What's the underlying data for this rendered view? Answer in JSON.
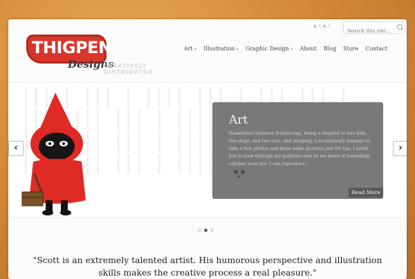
{
  "logo": {
    "title": "THIGPEN",
    "subtitle": "Designs",
    "tagline": "CREATIVELY DISTRIBUTED"
  },
  "header": {
    "social": "▪ t ▪ f",
    "search": {
      "placeholder": "Search this site..."
    }
  },
  "nav": {
    "items": [
      {
        "label": "Art",
        "has_dropdown": true
      },
      {
        "label": "Illustration",
        "has_dropdown": true
      },
      {
        "label": "Graphic Design",
        "has_dropdown": true
      },
      {
        "label": "About",
        "has_dropdown": false
      },
      {
        "label": "Blog",
        "has_dropdown": false
      },
      {
        "label": "Store",
        "has_dropdown": false
      },
      {
        "label": "Contact",
        "has_dropdown": false
      }
    ],
    "dropdown_glyph": "»"
  },
  "slider": {
    "prev_label": "‹",
    "next_label": "›",
    "caption": {
      "title": "Art",
      "text": "Sometimes between freelancing, being a stepdad to two kids, two dogs, and two cats, and sleeping, I occasionally manage to take a few photos and draw some pictures just for fun. I invite you to look through my galleries and let me know if something catches your eye. I can reproduce...",
      "read_more": "Read More"
    },
    "dots": [
      false,
      true,
      false
    ]
  },
  "quote": "\"Scott is an extremely talented artist. His humorous perspective and illustration skills makes the creative process a real pleasure.\"",
  "colors": {
    "brand_red": "#d9362b",
    "caption_bg": "#6e6e6e",
    "background": "#d48a38"
  }
}
